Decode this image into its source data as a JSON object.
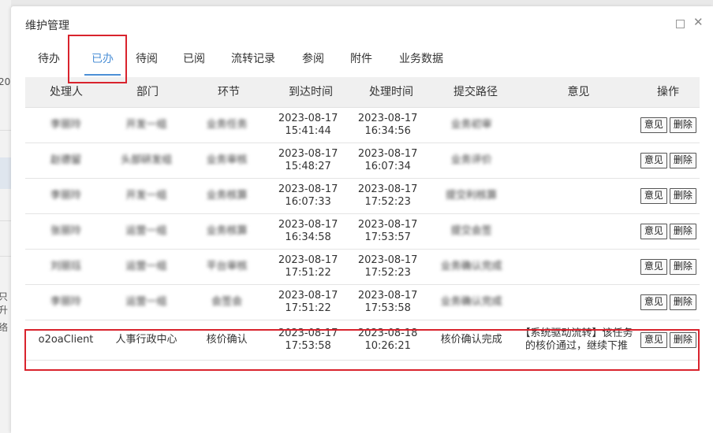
{
  "background": {
    "fragments": [
      "20",
      "只升",
      "络"
    ]
  },
  "dialog": {
    "title": "维护管理"
  },
  "tabs": [
    {
      "label": "待办",
      "active": false
    },
    {
      "label": "已办",
      "active": true
    },
    {
      "label": "待阅",
      "active": false
    },
    {
      "label": "已阅",
      "active": false
    },
    {
      "label": "流转记录",
      "active": false
    },
    {
      "label": "参阅",
      "active": false
    },
    {
      "label": "附件",
      "active": false
    },
    {
      "label": "业务数据",
      "active": false
    }
  ],
  "table": {
    "headers": [
      "处理人",
      "部门",
      "环节",
      "到达时间",
      "处理时间",
      "提交路径",
      "意见",
      "操作"
    ],
    "buttons": {
      "opinion": "意见",
      "delete": "删除"
    },
    "rows": [
      {
        "person": "李丽玲",
        "dept": "开发一组",
        "step": "业务任务",
        "arrive_date": "2023-08-17",
        "arrive_time": "15:41:44",
        "handle_date": "2023-08-17",
        "handle_time": "16:34:56",
        "path": "业务初审",
        "opinion": "",
        "blurred": true
      },
      {
        "person": "赵德留",
        "dept": "头部研发组",
        "step": "业务审核",
        "arrive_date": "2023-08-17",
        "arrive_time": "15:48:27",
        "handle_date": "2023-08-17",
        "handle_time": "16:07:34",
        "path": "业务评价",
        "opinion": "",
        "blurred": true
      },
      {
        "person": "李丽玲",
        "dept": "开发一组",
        "step": "业务核算",
        "arrive_date": "2023-08-17",
        "arrive_time": "16:07:33",
        "handle_date": "2023-08-17",
        "handle_time": "17:52:23",
        "path": "提交利核算",
        "opinion": "",
        "blurred": true
      },
      {
        "person": "张丽玲",
        "dept": "运营一组",
        "step": "业务核算",
        "arrive_date": "2023-08-17",
        "arrive_time": "16:34:58",
        "handle_date": "2023-08-17",
        "handle_time": "17:53:57",
        "path": "提交会签",
        "opinion": "",
        "blurred": true
      },
      {
        "person": "刘丽珏",
        "dept": "运营一组",
        "step": "平台审核",
        "arrive_date": "2023-08-17",
        "arrive_time": "17:51:22",
        "handle_date": "2023-08-17",
        "handle_time": "17:52:23",
        "path": "业务确认完成",
        "opinion": "",
        "blurred": true
      },
      {
        "person": "李丽玲",
        "dept": "运营一组",
        "step": "会签会",
        "arrive_date": "2023-08-17",
        "arrive_time": "17:51:22",
        "handle_date": "2023-08-17",
        "handle_time": "17:53:58",
        "path": "业务确认完成",
        "opinion": "",
        "blurred": true
      },
      {
        "person": "o2oaClient",
        "dept": "人事行政中心",
        "step": "核价确认",
        "arrive_date": "2023-08-17",
        "arrive_time": "17:53:58",
        "handle_date": "2023-08-18",
        "handle_time": "10:26:21",
        "path": "核价确认完成",
        "opinion": "【系统驱动流转】该任务的核价通过，继续下推",
        "blurred": false
      }
    ]
  }
}
